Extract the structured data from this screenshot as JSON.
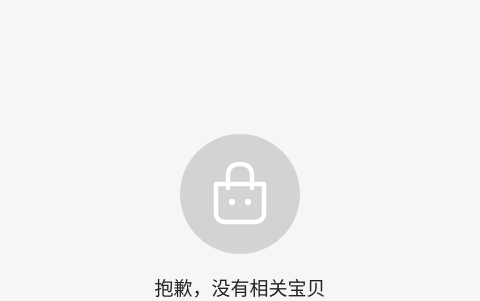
{
  "empty_state": {
    "icon": "shopping-bag-icon",
    "message": "抱歉，没有相关宝贝",
    "background_color": "#f6f6f6",
    "icon_circle_color": "#d3d3d3",
    "icon_stroke_color": "#ffffff"
  }
}
